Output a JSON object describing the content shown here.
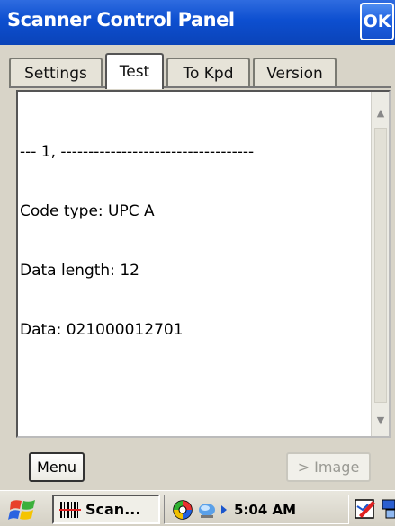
{
  "window": {
    "title": "Scanner Control Panel",
    "ok_label": "OK"
  },
  "tabs": [
    {
      "label": "Settings",
      "active": false
    },
    {
      "label": "Test",
      "active": true
    },
    {
      "label": "To Kpd",
      "active": false
    },
    {
      "label": "Version",
      "active": false
    }
  ],
  "output": {
    "lines": [
      "--- 1, -----------------------------------",
      "Code type: UPC A",
      "Data length: 12",
      "Data: 021000012701"
    ]
  },
  "buttons": {
    "menu_label": "Menu",
    "image_label": "> Image"
  },
  "taskbar": {
    "task_label": "Scan...",
    "clock": "5:04 AM"
  },
  "icons": {
    "start": "windows-flag-icon",
    "task": "barcode-icon",
    "tray": [
      "color-wheel-icon",
      "network-icon",
      "arrow-right-icon"
    ],
    "sip": "pen-input-icon",
    "desktop": "desktop-icon"
  },
  "colors": {
    "titlebar": "#0d4fd0",
    "title_text": "#ffffff",
    "background": "#d8d4c8",
    "disabled_text": "#9a9a94"
  }
}
